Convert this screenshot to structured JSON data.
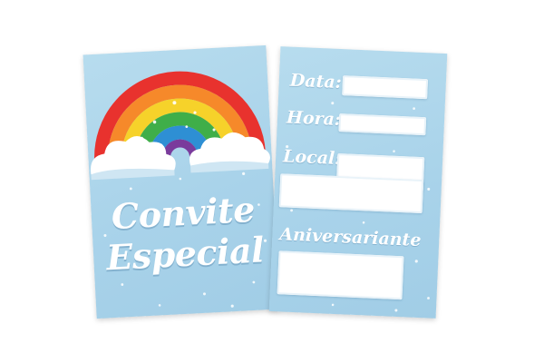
{
  "front_card": {
    "title_line1": "Convite",
    "title_line2": "Especial"
  },
  "back_card": {
    "fields": [
      {
        "label": "Data:"
      },
      {
        "label": "Hora:"
      },
      {
        "label": "Local:"
      },
      {
        "label": "Aniversariante"
      }
    ]
  },
  "colors": {
    "card_blue": "#a9d3ea",
    "text_white": "#ffffff",
    "rainbow_red": "#e8322e",
    "rainbow_orange": "#f6892a",
    "rainbow_yellow": "#f6d22a",
    "rainbow_green": "#3fae49",
    "rainbow_blue": "#2e8fd4",
    "rainbow_purple": "#7a3b9c"
  }
}
